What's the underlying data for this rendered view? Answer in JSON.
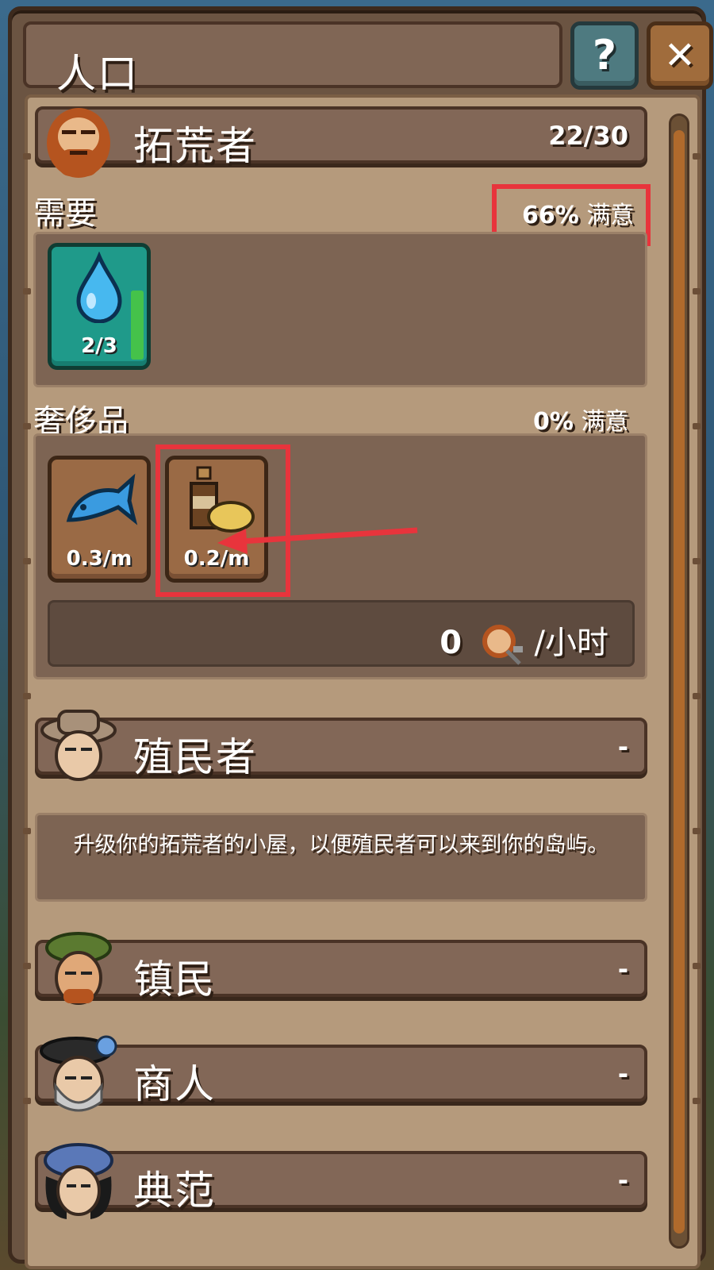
{
  "window": {
    "title": "人口",
    "help_label": "?",
    "close_label": "✕"
  },
  "classes": [
    {
      "name": "拓荒者",
      "count": "22/30",
      "needs": {
        "label": "需要",
        "satisfaction_value": "66%",
        "satisfaction_label": "满意",
        "items": [
          {
            "icon": "water-drop-icon",
            "value": "2/3",
            "fill_fraction": 0.67
          }
        ]
      },
      "luxury": {
        "label": "奢侈品",
        "satisfaction_value": "0%",
        "satisfaction_label": "满意",
        "items": [
          {
            "icon": "fish-icon",
            "value": "0.3/m"
          },
          {
            "icon": "liquor-potato-icon",
            "value": "0.2/m"
          }
        ]
      },
      "growth": {
        "value": "0",
        "unit": "/小时"
      }
    },
    {
      "name": "殖民者",
      "count": "-",
      "description": "升级你的拓荒者的小屋，以便殖民者可以来到你的岛屿。"
    },
    {
      "name": "镇民",
      "count": "-"
    },
    {
      "name": "商人",
      "count": "-"
    },
    {
      "name": "典范",
      "count": "-"
    }
  ],
  "colors": {
    "highlight": "#e8343c",
    "scroll_thumb": "#b06a2c"
  }
}
